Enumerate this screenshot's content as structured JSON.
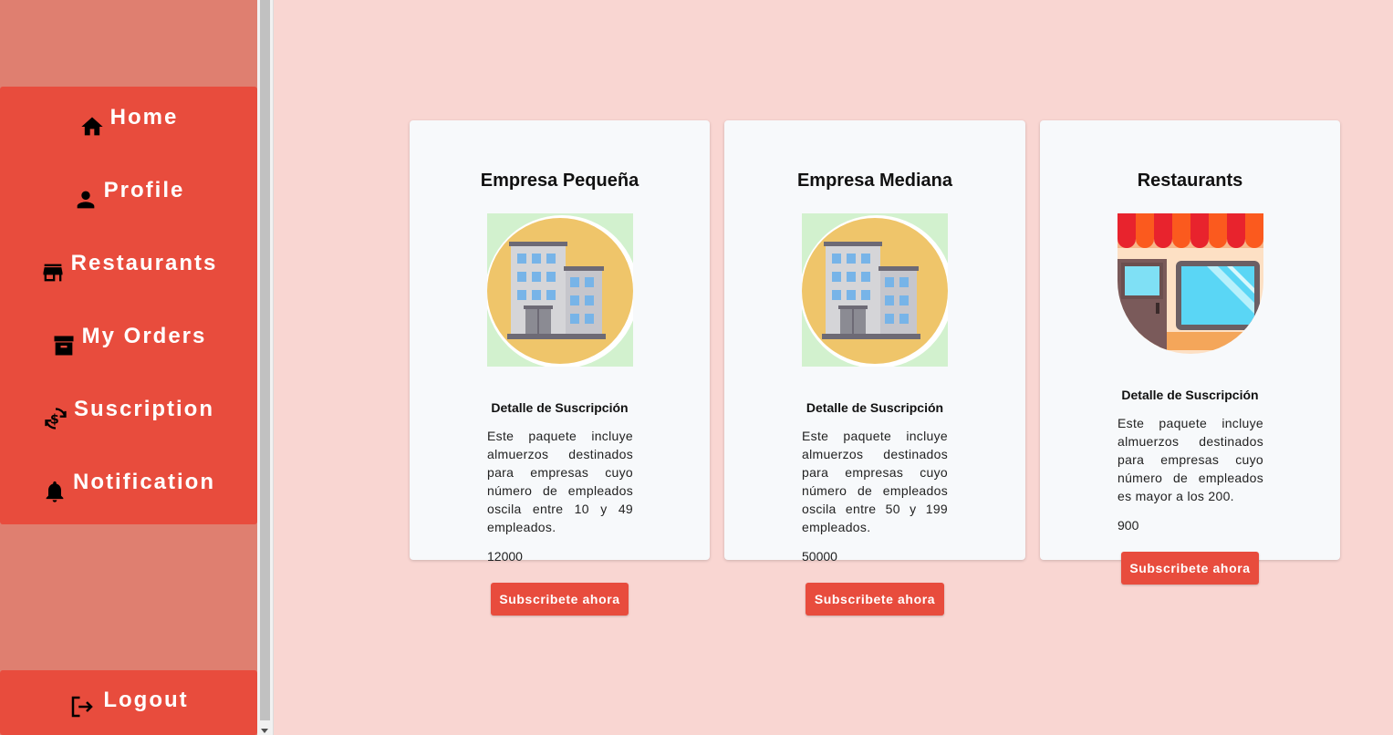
{
  "sidebar": {
    "items": [
      {
        "label": "Home",
        "icon": "home-icon"
      },
      {
        "label": "Profile",
        "icon": "person-icon"
      },
      {
        "label": "Restaurants",
        "icon": "store-icon"
      },
      {
        "label": "My Orders",
        "icon": "archive-icon"
      },
      {
        "label": "Suscription",
        "icon": "currency-exchange-icon"
      },
      {
        "label": "Notification",
        "icon": "bell-icon"
      }
    ],
    "logout": {
      "label": "Logout",
      "icon": "logout-icon"
    }
  },
  "cards": [
    {
      "title": "Empresa Pequeña",
      "image": "office-building-icon",
      "subtitle": "Detalle de Suscripción",
      "description": "Este paquete incluye almuerzos destinados para empresas cuyo número de empleados oscila entre 10 y 49 empleados.",
      "price": "12000",
      "button": "Subscribete ahora"
    },
    {
      "title": "Empresa Mediana",
      "image": "office-building-icon",
      "subtitle": "Detalle de Suscripción",
      "description": "Este paquete incluye almuerzos destinados para empresas cuyo número de empleados oscila entre 50 y 199 empleados.",
      "price": "50000",
      "button": "Subscribete ahora"
    },
    {
      "title": "Restaurants",
      "image": "storefront-icon",
      "subtitle": "Detalle de Suscripción",
      "description": "Este paquete incluye almuerzos destinados para empresas cuyo número de empleados es mayor a los 200.",
      "price": "900",
      "button": "Subscribete ahora"
    }
  ],
  "colors": {
    "page_background": "#f9d6d2",
    "sidebar_background": "#df7f70",
    "accent": "#e84c3d",
    "card_background": "#f7f9fb"
  }
}
